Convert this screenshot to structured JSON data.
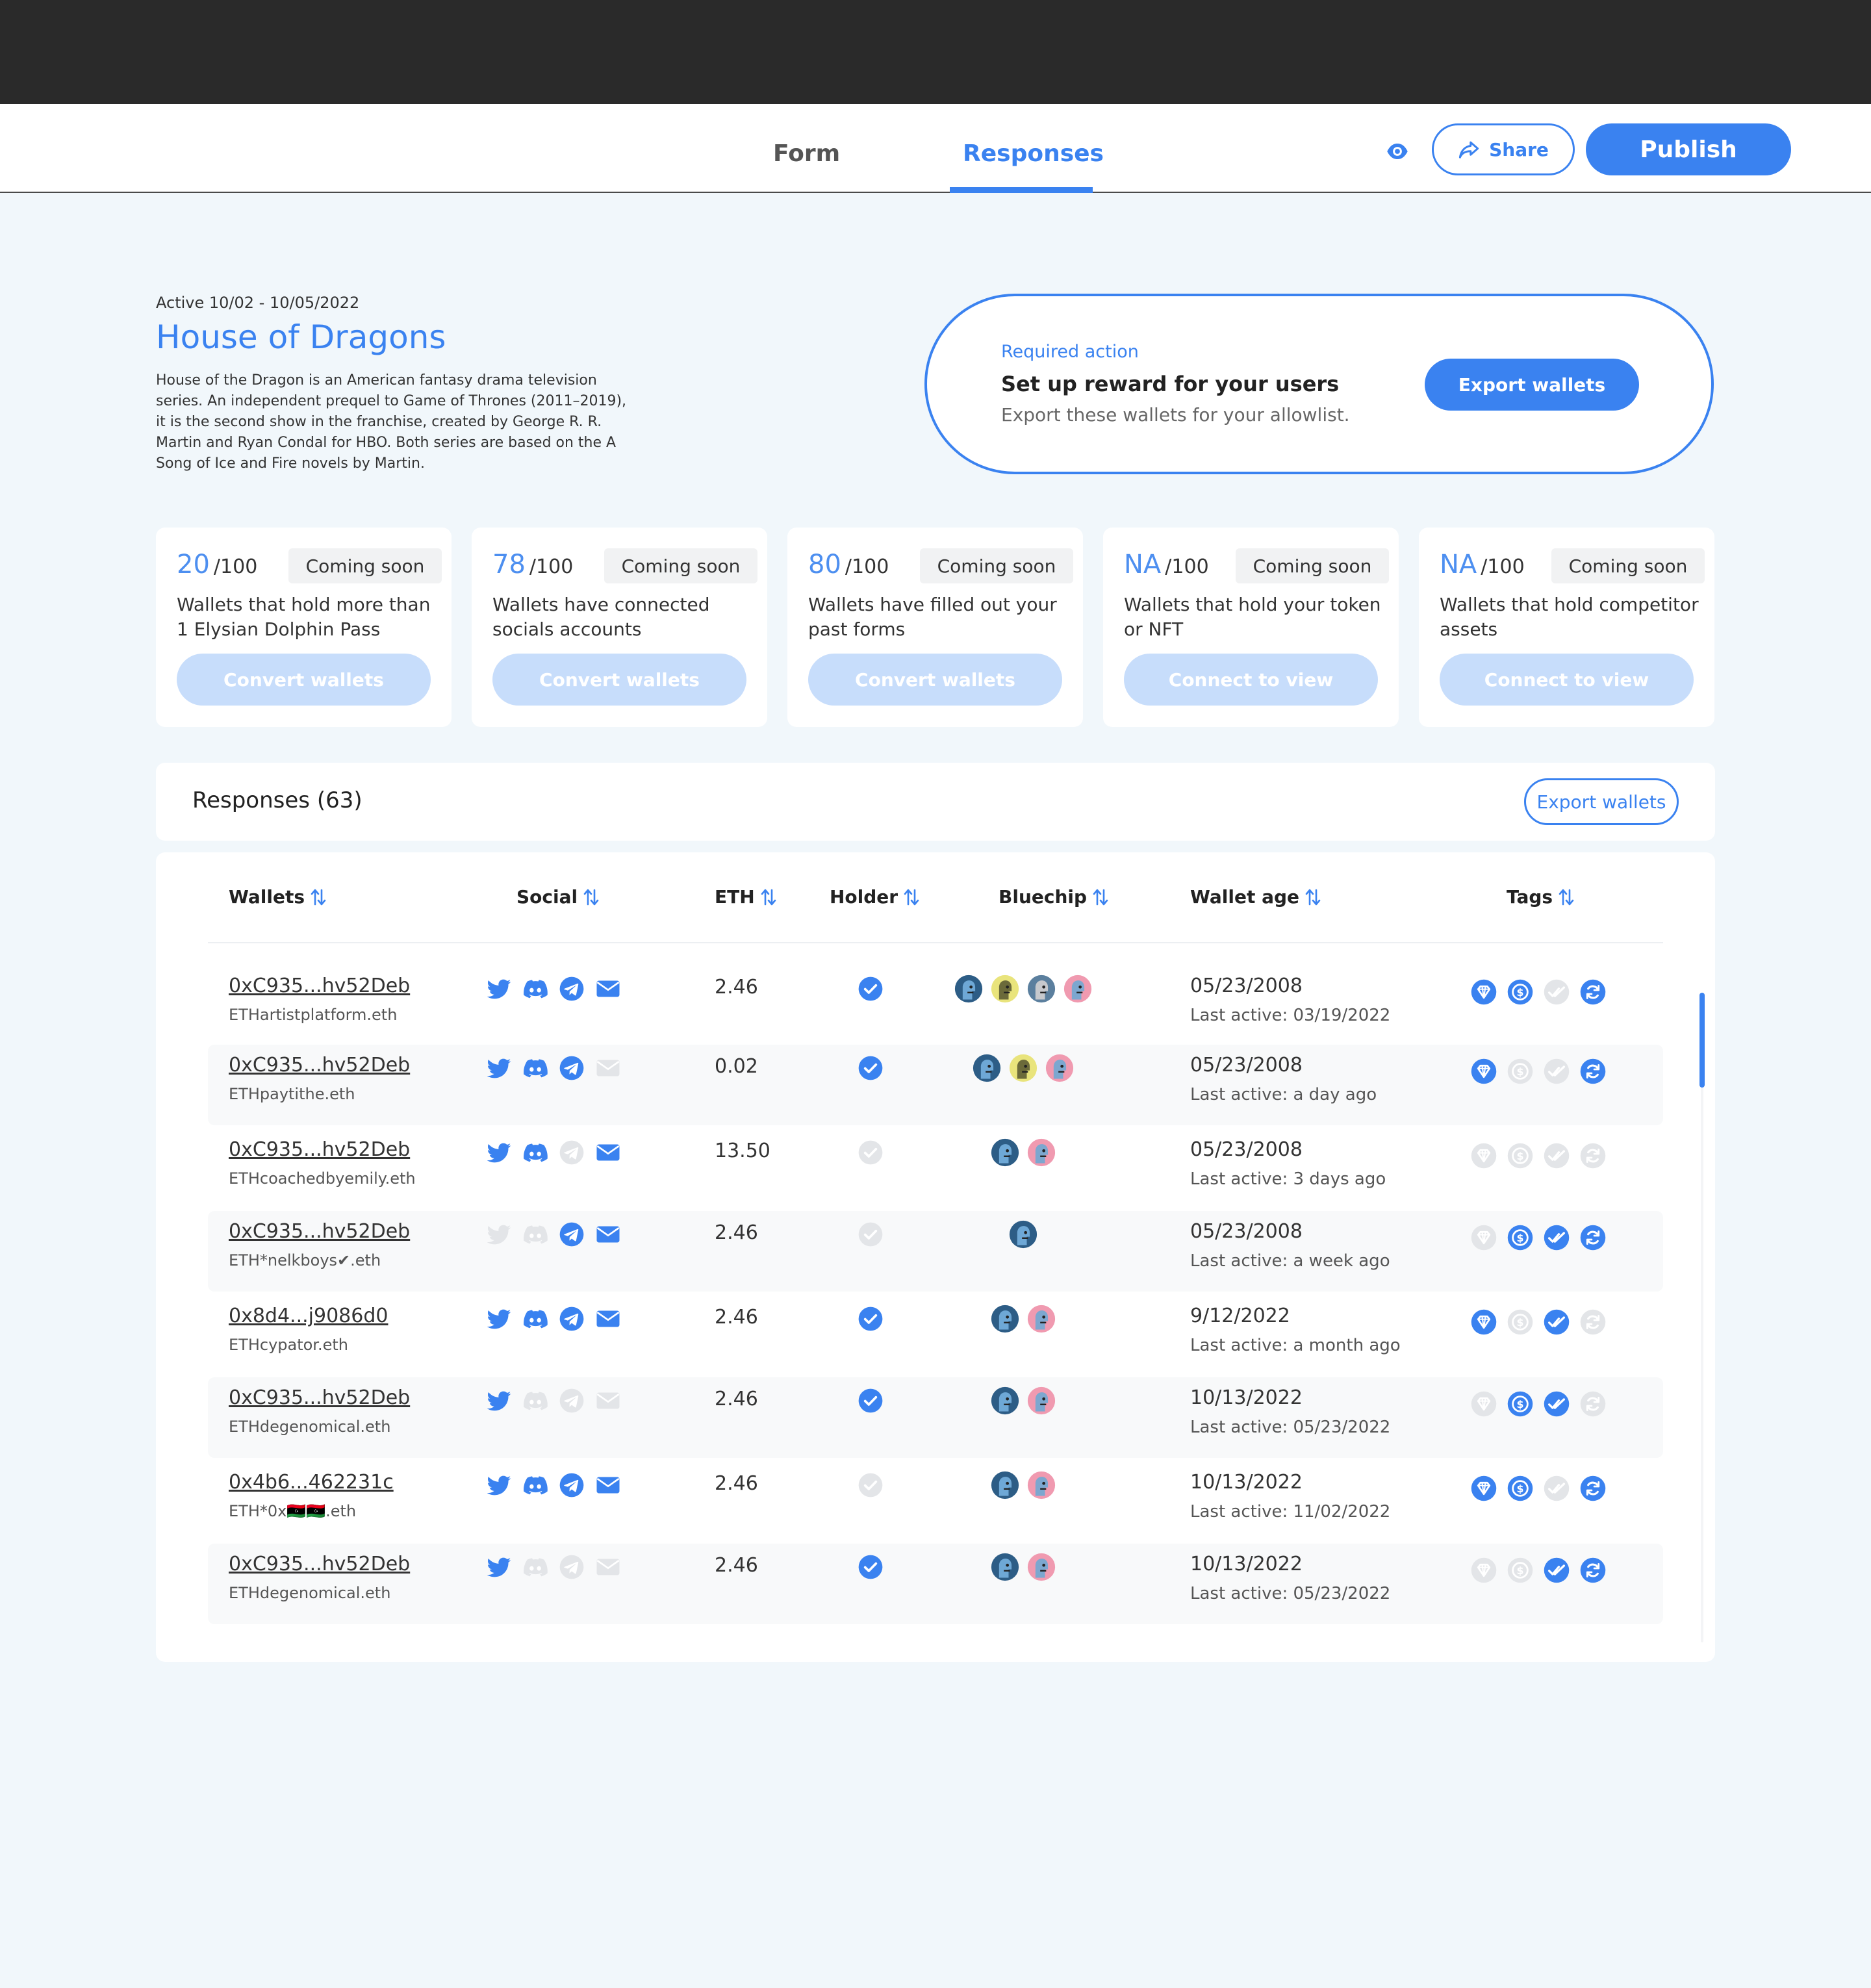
{
  "nav": {
    "tabs": [
      {
        "label": "Form"
      },
      {
        "label": "Responses"
      }
    ],
    "share_label": "Share",
    "publish_label": "Publish"
  },
  "form": {
    "active_dates": "Active 10/02 - 10/05/2022",
    "title": "House of Dragons",
    "description": "House of the Dragon is an American fantasy drama television series. An independent prequel to Game of Thrones (2011–2019), it is the second show in the franchise, created by George R. R. Martin and Ryan Condal for HBO. Both series are based on the A Song of Ice and Fire novels by Martin."
  },
  "required_action": {
    "label": "Required action",
    "title": "Set up reward for your users",
    "subtitle": "Export these wallets for your allowlist.",
    "button": "Export wallets"
  },
  "stats": [
    {
      "value": "20",
      "denominator": "/100",
      "badge": "Coming soon",
      "description": "Wallets that hold more than 1 Elysian Dolphin Pass",
      "button": "Convert wallets"
    },
    {
      "value": "78",
      "denominator": "/100",
      "badge": "Coming soon",
      "description": "Wallets have connected socials accounts",
      "button": "Convert wallets"
    },
    {
      "value": "80",
      "denominator": "/100",
      "badge": "Coming soon",
      "description": "Wallets have filled out your past forms",
      "button": "Convert wallets"
    },
    {
      "value": "NA",
      "denominator": "/100",
      "badge": "Coming soon",
      "description": "Wallets that hold your token or NFT",
      "button": "Connect to view"
    },
    {
      "value": "NA",
      "denominator": "/100",
      "badge": "Coming soon",
      "description": "Wallets that hold competitor assets",
      "button": "Connect to view"
    }
  ],
  "responses": {
    "title": "Responses (63)",
    "export_label": "Export wallets",
    "columns": [
      "Wallets",
      "Social",
      "ETH",
      "Holder",
      "Bluechip",
      "Wallet age",
      "Tags"
    ],
    "rows": [
      {
        "wallet": "0xC935...hv52Deb",
        "ens": "ETHartistplatform.eth",
        "eth": "2.46",
        "age": "05/23/2008",
        "last_active": "Last active: 03/19/2022",
        "social": [
          true,
          true,
          true,
          true
        ],
        "holder": true,
        "bluechip": [
          "ape-blue",
          "ape-yellow",
          "ape-gray",
          "ape-pink"
        ],
        "tags": [
          true,
          true,
          false,
          true
        ]
      },
      {
        "wallet": "0xC935...hv52Deb",
        "ens": "ETHpaytithe.eth",
        "eth": "0.02",
        "age": "05/23/2008",
        "last_active": "Last active: a day ago",
        "social": [
          true,
          true,
          true,
          false
        ],
        "holder": true,
        "bluechip": [
          "ape-blue",
          "ape-yellow",
          "ape-pink"
        ],
        "tags": [
          true,
          false,
          false,
          true
        ]
      },
      {
        "wallet": "0xC935...hv52Deb",
        "ens": "ETHcoachedbyemily.eth",
        "eth": "13.50",
        "age": "05/23/2008",
        "last_active": "Last active: 3 days ago",
        "social": [
          true,
          true,
          false,
          true
        ],
        "holder": false,
        "bluechip": [
          "ape-blue",
          "ape-pink"
        ],
        "tags": [
          false,
          false,
          false,
          false
        ]
      },
      {
        "wallet": "0xC935...hv52Deb",
        "ens": "ETH*nelkboys✔.eth",
        "eth": "2.46",
        "age": "05/23/2008",
        "last_active": "Last active: a week ago",
        "social": [
          false,
          false,
          true,
          true
        ],
        "holder": false,
        "bluechip": [
          "ape-blue"
        ],
        "tags": [
          false,
          true,
          true,
          true
        ]
      },
      {
        "wallet": "0x8d4...j9086d0",
        "ens": "ETHcypator.eth",
        "eth": "2.46",
        "age": "9/12/2022",
        "last_active": "Last active: a month ago",
        "social": [
          true,
          true,
          true,
          true
        ],
        "holder": true,
        "bluechip": [
          "ape-blue",
          "ape-pink"
        ],
        "tags": [
          true,
          false,
          true,
          false
        ]
      },
      {
        "wallet": "0xC935...hv52Deb",
        "ens": "ETHdegenomical.eth",
        "eth": "2.46",
        "age": "10/13/2022",
        "last_active": "Last active: 05/23/2022",
        "social": [
          true,
          false,
          false,
          false
        ],
        "holder": true,
        "bluechip": [
          "ape-blue",
          "ape-pink"
        ],
        "tags": [
          false,
          true,
          true,
          false
        ]
      },
      {
        "wallet": "0x4b6...462231c",
        "ens": "ETH*0x🇱🇾🇱🇾.eth",
        "eth": "2.46",
        "age": "10/13/2022",
        "last_active": "Last active: 11/02/2022",
        "social": [
          true,
          true,
          true,
          true
        ],
        "holder": false,
        "bluechip": [
          "ape-blue",
          "ape-pink"
        ],
        "tags": [
          true,
          true,
          false,
          true
        ]
      },
      {
        "wallet": "0xC935...hv52Deb",
        "ens": "ETHdegenomical.eth",
        "eth": "2.46",
        "age": "10/13/2022",
        "last_active": "Last active: 05/23/2022",
        "social": [
          true,
          false,
          false,
          false
        ],
        "holder": true,
        "bluechip": [
          "ape-blue",
          "ape-pink"
        ],
        "tags": [
          false,
          false,
          true,
          true
        ]
      }
    ]
  },
  "colors": {
    "accent": "#3a82f0",
    "muted": "#e3e5e8",
    "soft_button": "#c7ddfb"
  },
  "icons": {
    "social": [
      "twitter-icon",
      "discord-icon",
      "telegram-icon",
      "email-icon"
    ],
    "tags": [
      "diamond-icon",
      "dollar-icon",
      "double-check-icon",
      "refresh-icon"
    ]
  }
}
